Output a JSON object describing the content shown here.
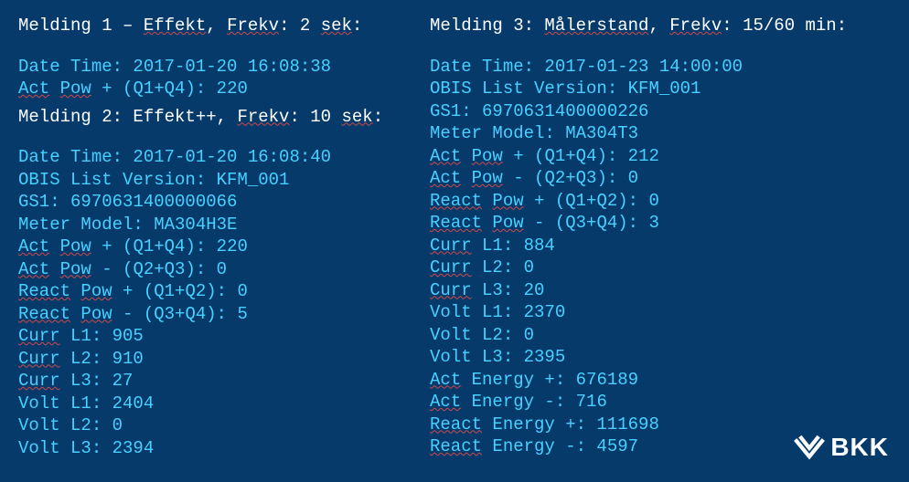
{
  "m1": {
    "title_a": "Melding 1 – ",
    "title_b": "Effekt",
    "title_c": ", ",
    "title_d": "Frekv",
    "title_e": ": 2 ",
    "title_f": "sek",
    "title_g": ":",
    "date": "Date Time: 2017-01-20 16:08:38",
    "actp_a": "Act",
    "actp_b": "Pow",
    "actp_c": " + (Q1+Q4): 220"
  },
  "m2": {
    "title_a": "Melding 2: Effekt++, ",
    "title_b": "Frekv",
    "title_c": ": 10 ",
    "title_d": "sek",
    "title_e": ":",
    "date": "Date Time: 2017-01-20 16:08:40",
    "obis": "OBIS List Version: KFM_001",
    "gs1": "GS1: 6970631400000066",
    "model": "Meter Model: MA304H3E",
    "ap_p": " + (Q1+Q4): 220",
    "ap_m": " - (Q2+Q3): 0",
    "rp_p": " + (Q1+Q2): 0",
    "rp_m": " - (Q3+Q4): 5",
    "cl1": " L1: 905",
    "cl2": " L2: 910",
    "cl3": " L3: 27",
    "vl1": "Volt L1: 2404",
    "vl2": "Volt L2: 0",
    "vl3": "Volt L3: 2394"
  },
  "m3": {
    "title_a": "Melding 3: ",
    "title_b": "Målerstand",
    "title_c": ", ",
    "title_d": "Frekv",
    "title_e": ": 15/60 min:",
    "date": "Date Time: 2017-01-23 14:00:00",
    "obis": "OBIS List Version: KFM_001",
    "gs1": "GS1: 6970631400000226",
    "model": "Meter Model: MA304T3",
    "ap_p": " + (Q1+Q4): 212",
    "ap_m": " - (Q2+Q3): 0",
    "rp_p": " + (Q1+Q2): 0",
    "rp_m": " - (Q3+Q4): 3",
    "cl1": " L1: 884",
    "cl2": " L2: 0",
    "cl3": " L3: 20",
    "vl1": "Volt L1: 2370",
    "vl2": "Volt L2: 0",
    "vl3": "Volt L3: 2395",
    "ae_p": " Energy +: 676189",
    "ae_m": " Energy -: 716",
    "re_p": " Energy +: 111698",
    "re_m": " Energy -: 4597"
  },
  "w": {
    "act": "Act",
    "pow": "Pow",
    "react": "React",
    "curr": "Curr",
    "sp": " "
  },
  "logo": {
    "text": "BKK"
  }
}
